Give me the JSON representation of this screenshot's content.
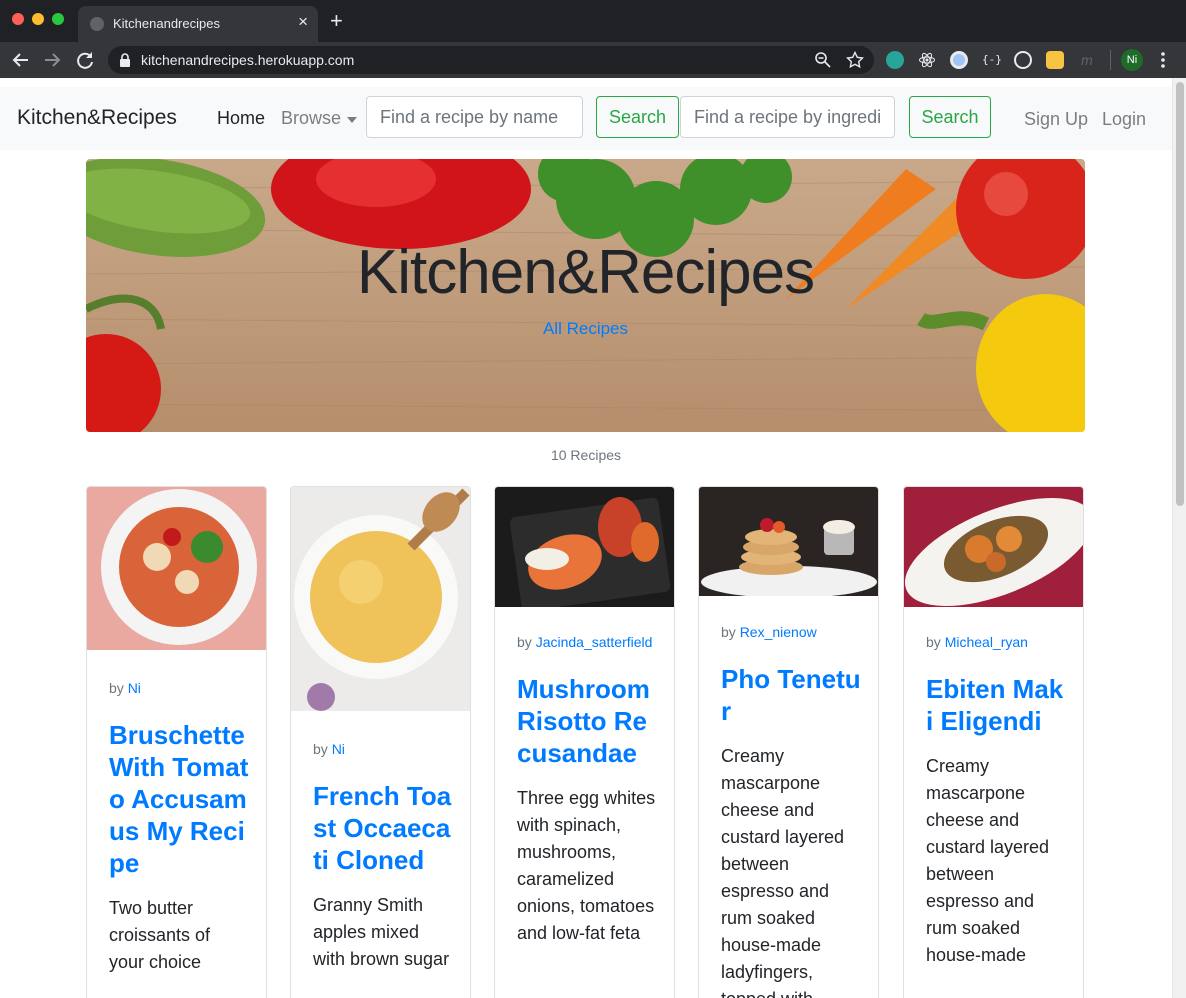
{
  "browser": {
    "tab_title": "Kitchenandrecipes",
    "url": "kitchenandrecipes.herokuapp.com",
    "profile_initials": "Ni"
  },
  "navbar": {
    "brand": "Kitchen&Recipes",
    "home": "Home",
    "browse": "Browse",
    "name_search_placeholder": "Find a recipe by name",
    "search_label": "Search",
    "ingredient_search_placeholder": "Find a recipe by ingredients",
    "signup": "Sign Up",
    "login": "Login"
  },
  "hero": {
    "title": "Kitchen&Recipes",
    "link": "All Recipes"
  },
  "recipe_count": "10 Recipes",
  "recipes": [
    {
      "by": "by",
      "author": "Ni",
      "title": "Bruschette With Tomato Accusamus My Recipe",
      "description": "Two butter croissants of your choice"
    },
    {
      "by": "by",
      "author": "Ni",
      "title": "French Toast Occaecati Cloned",
      "description": "Granny Smith apples mixed with brown sugar"
    },
    {
      "by": "by",
      "author": "Jacinda_satterfield",
      "title": "Mushroom Risotto Recusandae",
      "description": "Three egg whites with spinach, mushrooms, caramelized onions, tomatoes and low-fat feta"
    },
    {
      "by": "by",
      "author": "Rex_nienow",
      "title": "Pho Tenetur",
      "description": "Creamy mascarpone cheese and custard layered between espresso and rum soaked house-made ladyfingers, topped with"
    },
    {
      "by": "by",
      "author": "Micheal_ryan",
      "title": "Ebiten Maki Eligendi",
      "description": "Creamy mascarpone cheese and custard layered between espresso and rum soaked house-made"
    }
  ]
}
